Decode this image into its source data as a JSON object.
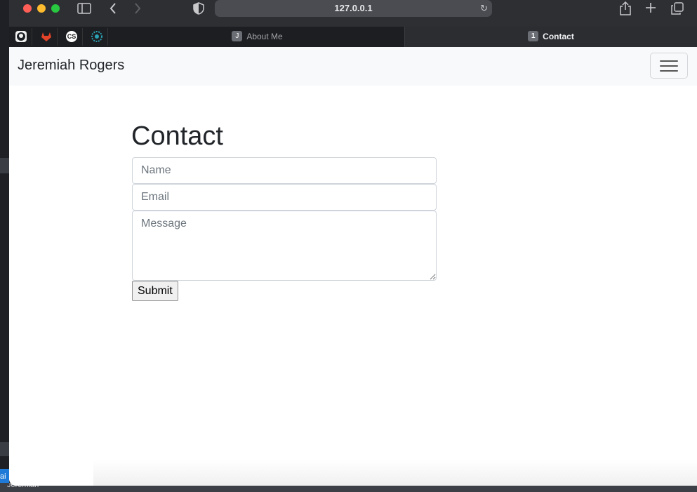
{
  "browser": {
    "url": "127.0.0.1",
    "tabs": [
      {
        "badge": "J",
        "label": "About Me",
        "active": false
      },
      {
        "badge": "1",
        "label": "Contact",
        "active": true
      }
    ],
    "pinned": [
      "github-icon",
      "gitlab-icon",
      "cs-icon",
      "pinwheel-icon"
    ],
    "pinned_cs_text": "CS"
  },
  "navbar": {
    "brand": "Jeremiah Rogers"
  },
  "page": {
    "heading": "Contact",
    "form": {
      "name_placeholder": "Name",
      "email_placeholder": "Email",
      "message_placeholder": "Message",
      "submit_label": "Submit"
    }
  },
  "desktop": {
    "dock_label": "Jeremiah",
    "left_label": "ai"
  },
  "colors": {
    "brand_text": "#212529",
    "navbar_bg": "#f8f9fa",
    "toolbar_bg": "#2d2f33"
  }
}
